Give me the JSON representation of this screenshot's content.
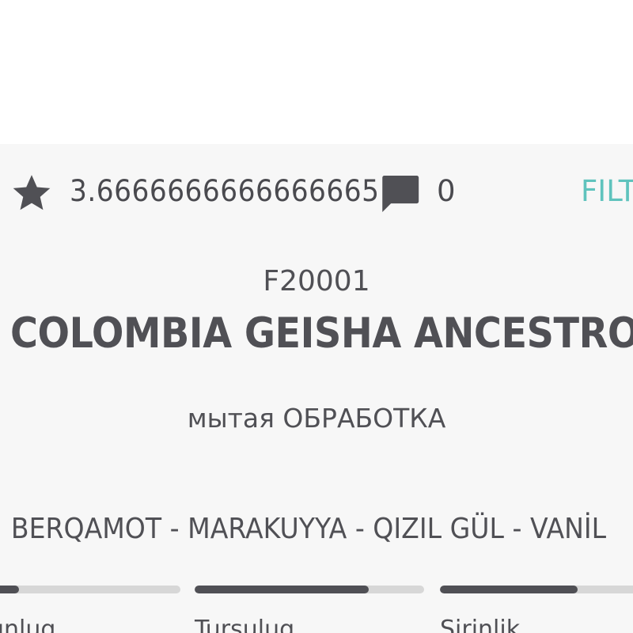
{
  "stats": {
    "rating": "3.6666666666666665",
    "rating_icon": "star-icon",
    "comments_count": "0",
    "comments_icon": "comment-icon",
    "filter_label": "FILT"
  },
  "product": {
    "code": "F20001",
    "name": "COLOMBIA GEISHA ANCESTRO",
    "processing": "мытая ОБРАБОТКА",
    "flavors": "BERQAMOT - MARAKUYYA - QIZIL GÜL - VANİL"
  },
  "attributes": [
    {
      "label": "unluq",
      "level": 0.24
    },
    {
      "label": "Turşuluq",
      "level": 0.76
    },
    {
      "label": "Şirinlik",
      "level": 0.6
    }
  ],
  "colors": {
    "accent": "#5fc3bd",
    "text": "#505055",
    "bar_track": "#d7d7d7",
    "bar_fill": "#505055",
    "card_background": "#f7f7f7"
  }
}
